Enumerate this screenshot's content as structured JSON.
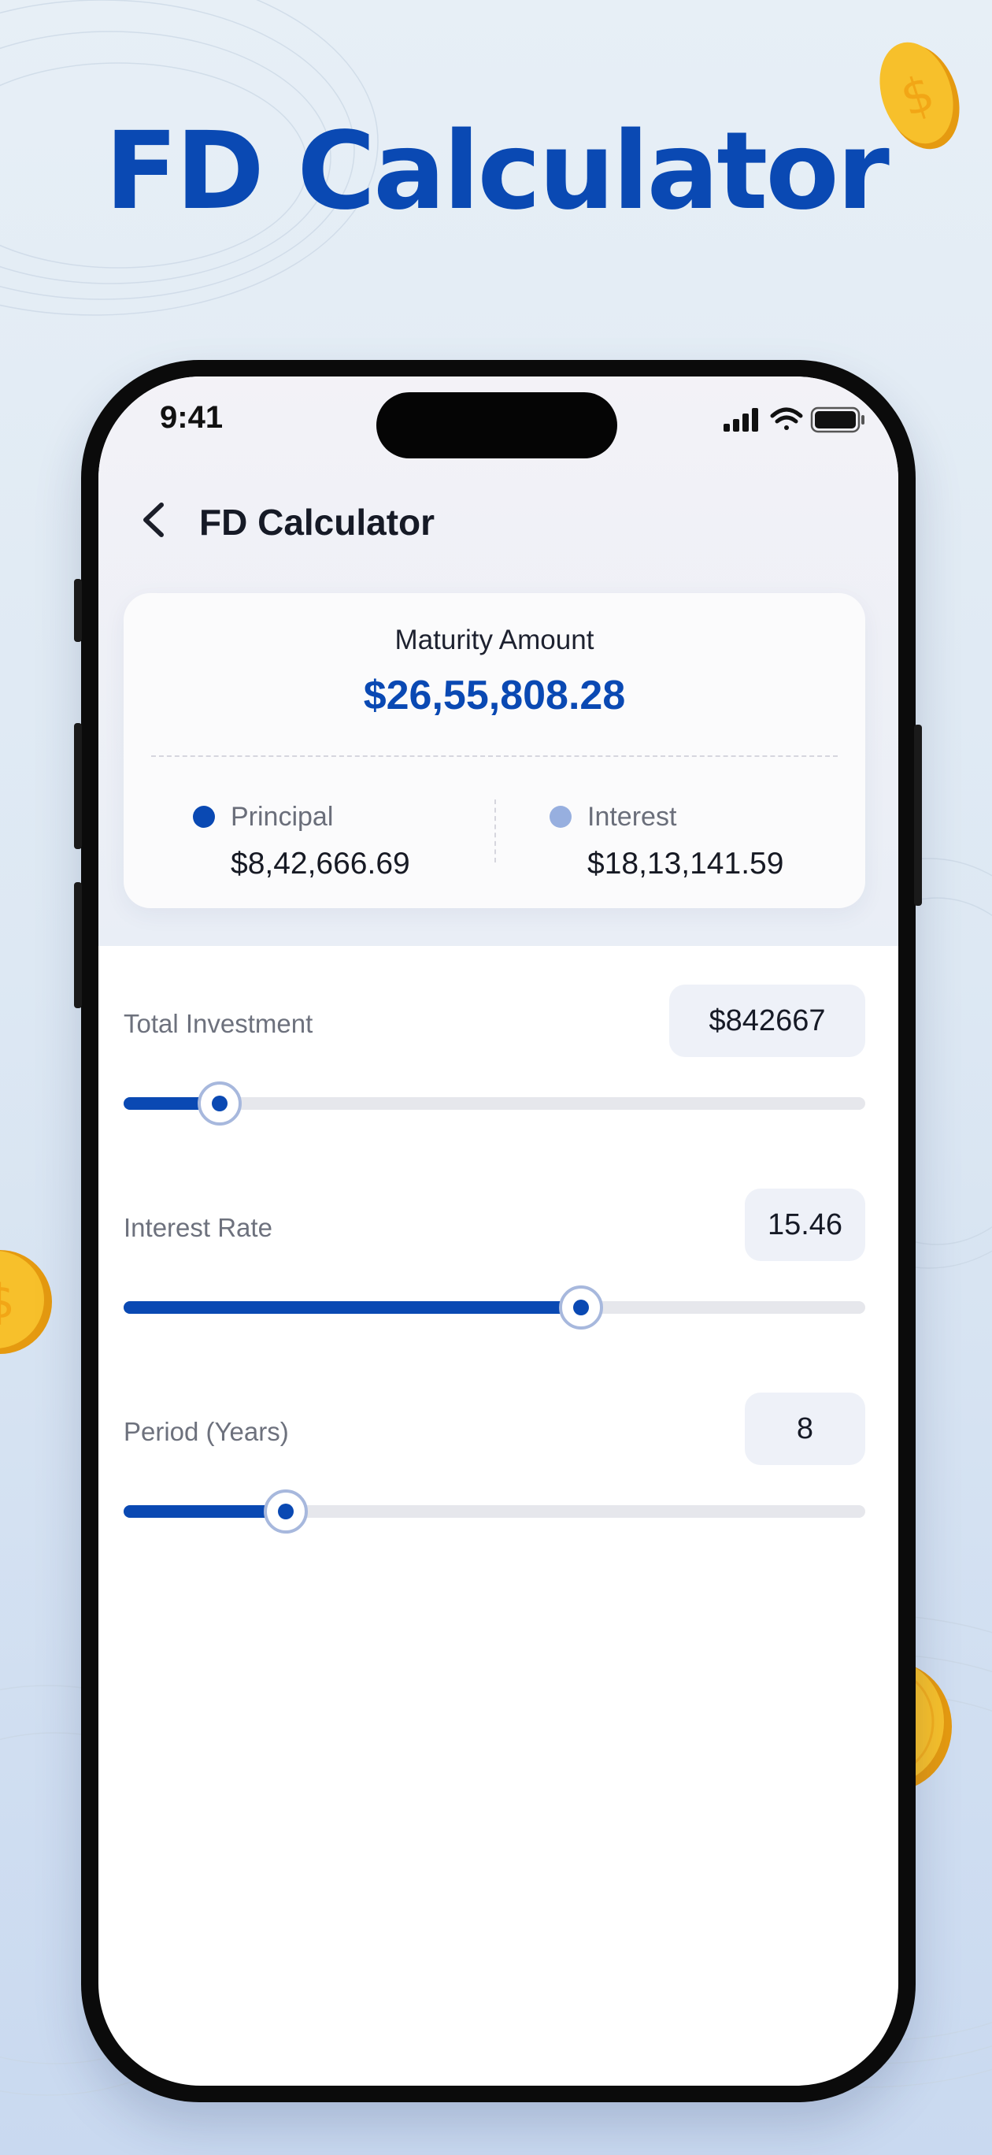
{
  "promo": {
    "headline": "FD Calculator"
  },
  "status_bar": {
    "time": "9:41",
    "icons": [
      "signal-icon",
      "wifi-icon",
      "battery-icon"
    ]
  },
  "nav": {
    "back_icon": "chevron-left-icon",
    "title": "FD Calculator"
  },
  "summary": {
    "maturity_label": "Maturity Amount",
    "maturity_value": "$26,55,808.28",
    "principal_label": "Principal",
    "principal_value": "$8,42,666.69",
    "interest_label": "Interest",
    "interest_value": "$18,13,141.59"
  },
  "inputs": [
    {
      "label": "Total Investment",
      "value": "$842667",
      "slider_fraction": 0.13
    },
    {
      "label": "Interest Rate",
      "value": "15.46",
      "slider_fraction": 0.617
    },
    {
      "label": "Period (Years)",
      "value": "8",
      "slider_fraction": 0.219
    }
  ],
  "colors": {
    "accent": "#0a49b3",
    "accent_light": "#97afdf",
    "track": "#e6e7ec",
    "coin": "#f5b719"
  }
}
